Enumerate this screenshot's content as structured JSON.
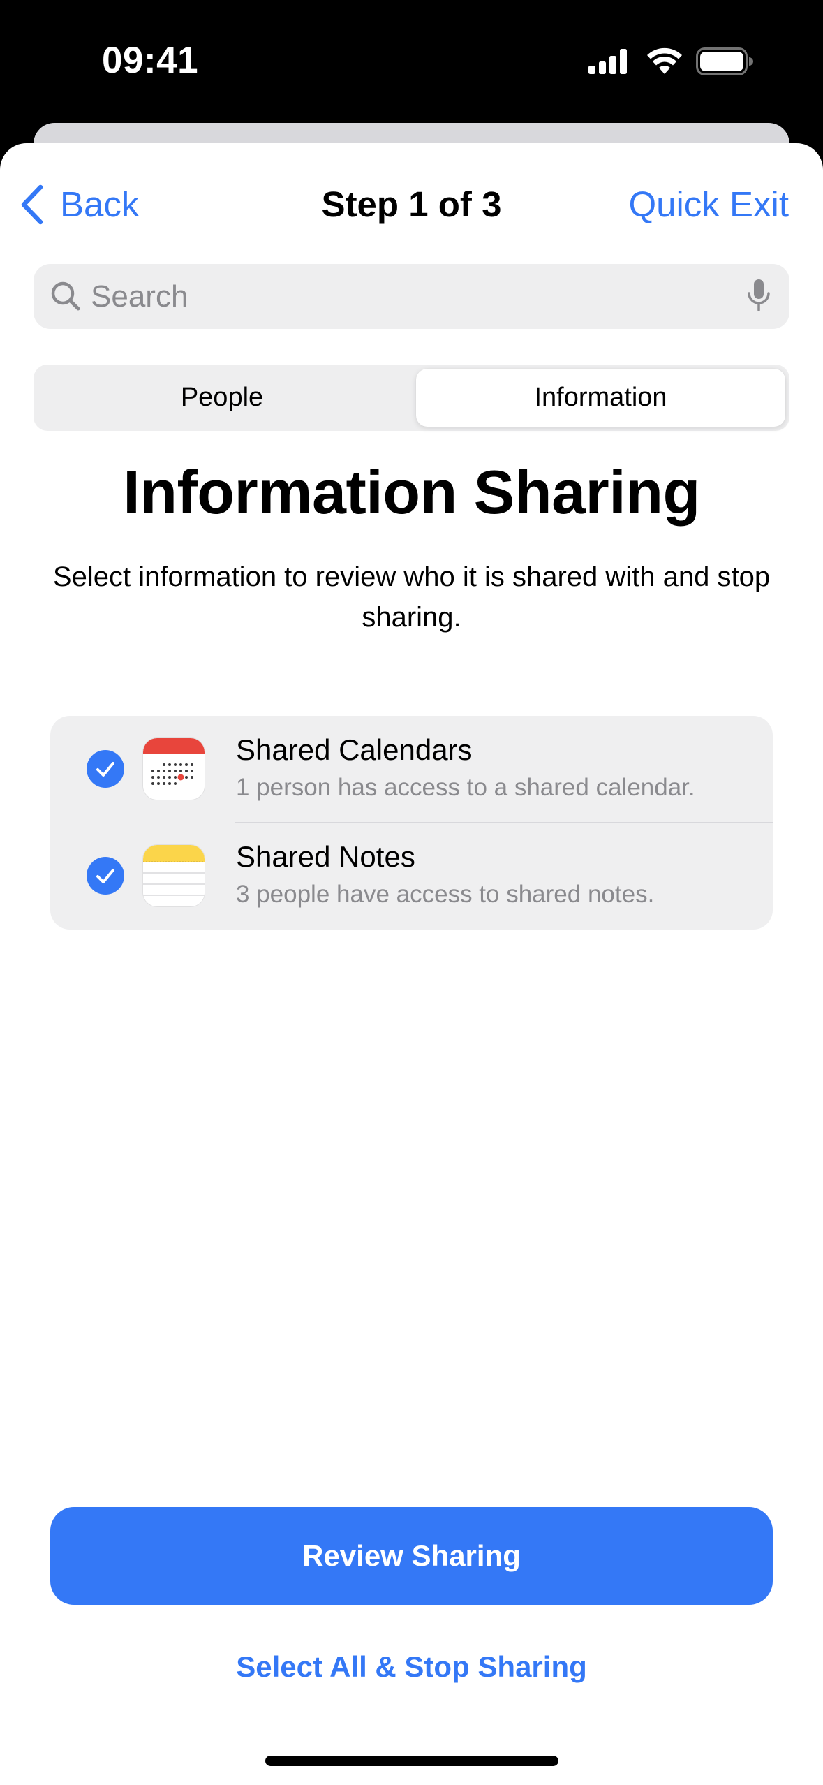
{
  "status_bar": {
    "time": "09:41",
    "icons": [
      "cellular-signal-icon",
      "wifi-icon",
      "battery-icon"
    ]
  },
  "nav": {
    "back_label": "Back",
    "title": "Step 1 of 3",
    "exit_label": "Quick Exit"
  },
  "search": {
    "placeholder": "Search",
    "value": ""
  },
  "segments": {
    "items": [
      {
        "label": "People",
        "selected": false
      },
      {
        "label": "Information",
        "selected": true
      }
    ]
  },
  "content": {
    "heading": "Information Sharing",
    "description": "Select information to review who it is shared with and stop sharing."
  },
  "list": {
    "items": [
      {
        "title": "Shared Calendars",
        "subtitle": "1 person has access to a shared calendar.",
        "checked": true,
        "icon": "calendar-app-icon"
      },
      {
        "title": "Shared Notes",
        "subtitle": "3 people have access to shared notes.",
        "checked": true,
        "icon": "notes-app-icon"
      }
    ]
  },
  "actions": {
    "primary_label": "Review Sharing",
    "secondary_label": "Select All & Stop Sharing"
  },
  "colors": {
    "accent": "#3478f6",
    "background": "#ffffff",
    "grouped_background": "#efeff0",
    "secondary_text": "#8a8a8e"
  }
}
